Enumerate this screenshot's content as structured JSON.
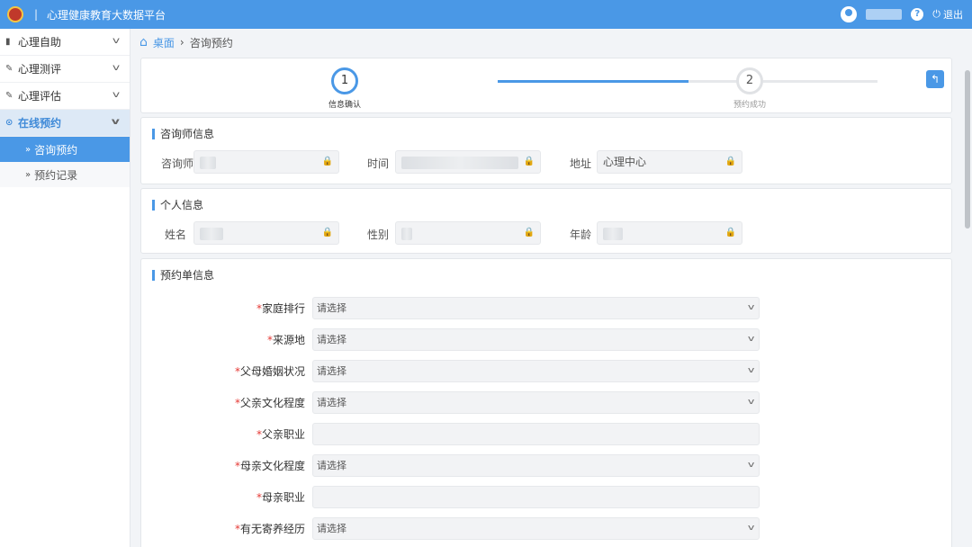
{
  "header": {
    "title": "心理健康教育大数据平台",
    "separator": "|",
    "help": "?",
    "logout_label": "退出"
  },
  "sidebar": {
    "items": [
      {
        "label": "心理自助"
      },
      {
        "label": "心理测评"
      },
      {
        "label": "心理评估"
      },
      {
        "label": "在线预约"
      }
    ],
    "subitems": [
      {
        "label": "咨询预约"
      },
      {
        "label": "预约记录"
      }
    ]
  },
  "breadcrumb": {
    "home": "桌面",
    "current": "咨询预约"
  },
  "steps": [
    {
      "num": "1",
      "label": "信息确认"
    },
    {
      "num": "2",
      "label": "预约成功"
    }
  ],
  "counselor": {
    "title": "咨询师信息",
    "name_label": "咨询师",
    "time_label": "时间",
    "address_label": "地址",
    "address_value": "心理中心"
  },
  "personal": {
    "title": "个人信息",
    "name_label": "姓名",
    "gender_label": "性别",
    "age_label": "年龄"
  },
  "form": {
    "title": "预约单信息",
    "required_mark": "*",
    "placeholder": "请选择",
    "fields": [
      {
        "label": "家庭排行",
        "type": "select"
      },
      {
        "label": "来源地",
        "type": "select"
      },
      {
        "label": "父母婚姻状况",
        "type": "select"
      },
      {
        "label": "父亲文化程度",
        "type": "select"
      },
      {
        "label": "父亲职业",
        "type": "text"
      },
      {
        "label": "母亲文化程度",
        "type": "select"
      },
      {
        "label": "母亲职业",
        "type": "text"
      },
      {
        "label": "有无寄养经历",
        "type": "select"
      }
    ]
  },
  "colors": {
    "accent": "#4a98e6",
    "required": "#e53935",
    "lock": "#e05a5a"
  }
}
